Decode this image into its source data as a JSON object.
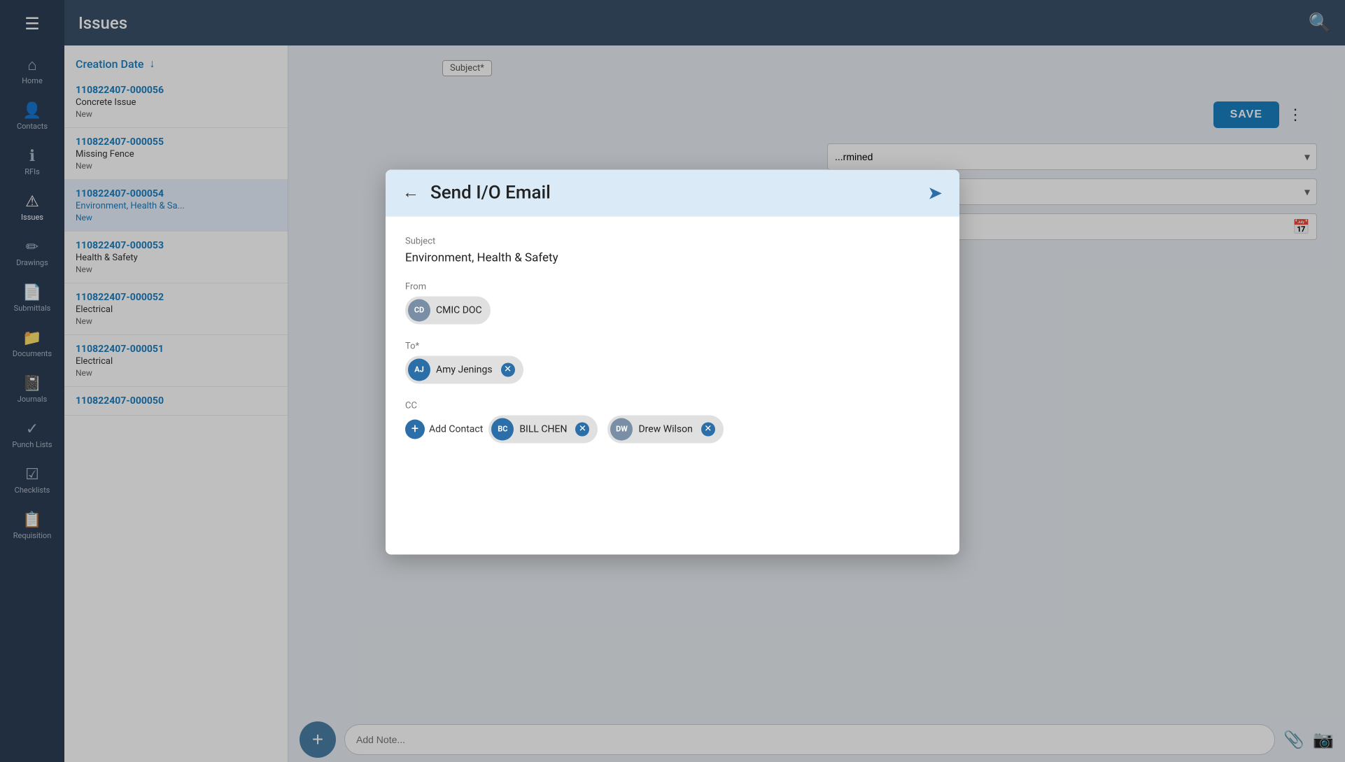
{
  "app": {
    "title": "Issues"
  },
  "sidebar": {
    "menu_icon": "☰",
    "items": [
      {
        "id": "home",
        "label": "Home",
        "icon": "⌂"
      },
      {
        "id": "contacts",
        "label": "Contacts",
        "icon": "👤"
      },
      {
        "id": "rfis",
        "label": "RFIs",
        "icon": "ℹ"
      },
      {
        "id": "issues",
        "label": "Issues",
        "icon": "⚠",
        "active": true
      },
      {
        "id": "drawings",
        "label": "Drawings",
        "icon": "✏"
      },
      {
        "id": "submittals",
        "label": "Submittals",
        "icon": "📄"
      },
      {
        "id": "documents",
        "label": "Documents",
        "icon": "📁"
      },
      {
        "id": "journals",
        "label": "Journals",
        "icon": "📓"
      },
      {
        "id": "punch-lists",
        "label": "Punch Lists",
        "icon": "✓"
      },
      {
        "id": "checklists",
        "label": "Checklists",
        "icon": "☑"
      },
      {
        "id": "requisition",
        "label": "Requisition",
        "icon": "📋"
      }
    ]
  },
  "issues_list": {
    "sort_label": "Creation Date",
    "sort_icon": "↓",
    "items": [
      {
        "number": "110822407-000056",
        "title": "Concrete Issue",
        "status": "New"
      },
      {
        "number": "110822407-000055",
        "title": "Missing Fence",
        "status": "New"
      },
      {
        "number": "110822407-000054",
        "title": "Environment, Health & Sa...",
        "status": "New",
        "active": true
      },
      {
        "number": "110822407-000053",
        "title": "Health & Safety",
        "status": "New"
      },
      {
        "number": "110822407-000052",
        "title": "Electrical",
        "status": "New"
      },
      {
        "number": "110822407-000051",
        "title": "Electrical",
        "status": "New"
      },
      {
        "number": "110822407-000050",
        "title": "",
        "status": ""
      }
    ]
  },
  "bottom_bar": {
    "add_note_placeholder": "Add Note...",
    "add_fab_label": "+"
  },
  "modal": {
    "title": "Send I/O Email",
    "back_icon": "←",
    "send_icon": "➤",
    "subject_label": "Subject",
    "subject_value": "Environment, Health & Safety",
    "from_label": "From",
    "from_avatar": "CD",
    "from_name": "CMIC DOC",
    "to_label": "To*",
    "to_recipients": [
      {
        "avatar": "AJ",
        "name": "Amy Jenings",
        "removable": true
      }
    ],
    "cc_label": "CC",
    "cc_add_label": "Add Contact",
    "cc_recipients": [
      {
        "avatar": "BC",
        "name": "BILL CHEN",
        "removable": true,
        "dark": true
      },
      {
        "avatar": "DW",
        "name": "Drew Wilson",
        "removable": true,
        "dark": false
      }
    ]
  },
  "topbar": {
    "search_icon": "🔍",
    "save_label": "SAVE",
    "more_icon": "⋮"
  }
}
